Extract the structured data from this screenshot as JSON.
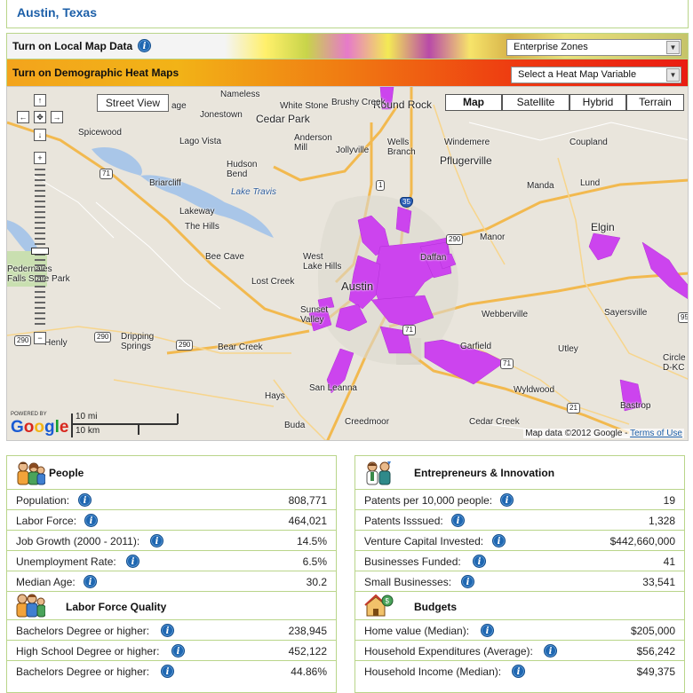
{
  "header": {
    "city": "Austin, Texas"
  },
  "local_map": {
    "label": "Turn on Local Map Data",
    "select_value": "Enterprise Zones"
  },
  "heat_map": {
    "label": "Turn on Demographic Heat Maps",
    "select_value": "Select a Heat Map Variable"
  },
  "map": {
    "street_view": "Street View",
    "types": [
      "Map",
      "Satellite",
      "Hybrid",
      "Terrain"
    ],
    "active_type": "Map",
    "scale_mi": "10 mi",
    "scale_km": "10 km",
    "powered_by": "POWERED BY",
    "logo": "Google",
    "attribution": "Map data ©2012 Google - ",
    "terms": "Terms of Use",
    "places": {
      "nameless": "Nameless",
      "round_rock": "Round Rock",
      "white_stone": "White Stone",
      "brushy_creek": "Brushy Creek",
      "jonestown": "Jonestown",
      "cedar_park": "Cedar Park",
      "spicewood": "Spicewood",
      "lago_vista": "Lago Vista",
      "anderson_mill": "Anderson\nMill",
      "jollyville": "Jollyville",
      "wells_branch": "Wells\nBranch",
      "windemere": "Windemere",
      "pflugerville": "Pflugerville",
      "coupland": "Coupland",
      "briarcliff": "Briarcliff",
      "hudson_bend": "Hudson\nBend",
      "lake_travis": "Lake Travis",
      "manda": "Manda",
      "lund": "Lund",
      "lakeway": "Lakeway",
      "the_hills": "The Hills",
      "elgin": "Elgin",
      "manor": "Manor",
      "bee_cave": "Bee Cave",
      "west_lake_hills": "West\nLake Hills",
      "daffan": "Daffan",
      "pedernales": "Pedernales\nFalls State Park",
      "lost_creek": "Lost Creek",
      "austin": "Austin",
      "webberville": "Webberville",
      "sayersville": "Sayersville",
      "sunset_valley": "Sunset\nValley",
      "henly": "Henly",
      "dripping_springs": "Dripping\nSprings",
      "garfield": "Garfield",
      "utley": "Utley",
      "bear_creek": "Bear Creek",
      "circle_d": "Circle\nD-KC",
      "wyldwood": "Wyldwood",
      "hays": "Hays",
      "san_leanna": "San Leanna",
      "cedar_creek": "Cedar Creek",
      "bastrop": "Bastrop",
      "creedmoor": "Creedmoor",
      "buda": "Buda",
      "sage": "age"
    },
    "shields": {
      "s71a": "71",
      "s1": "1",
      "s35": "35",
      "s290a": "290",
      "s71b": "71",
      "s290b": "290",
      "s290c": "290",
      "s290d": "290",
      "s71c": "71",
      "s21": "21",
      "s71d": "71",
      "s95": "95"
    }
  },
  "people": {
    "title": "People",
    "rows": [
      {
        "label": "Population:",
        "value": "808,771"
      },
      {
        "label": "Labor Force:",
        "value": "464,021"
      },
      {
        "label": "Job Growth (2000 - 2011):",
        "value": "14.5%"
      },
      {
        "label": "Unemployment Rate:",
        "value": "6.5%"
      },
      {
        "label": "Median Age:",
        "value": "30.2"
      }
    ]
  },
  "labor": {
    "title": "Labor Force Quality",
    "rows": [
      {
        "label": "Bachelors Degree or higher:",
        "value": "238,945"
      },
      {
        "label": "High School Degree or higher:",
        "value": "452,122"
      },
      {
        "label": "Bachelors Degree or higher:",
        "value": "44.86%"
      }
    ]
  },
  "entrepreneurs": {
    "title": "Entrepreneurs & Innovation",
    "rows": [
      {
        "label": "Patents per 10,000 people:",
        "value": "19"
      },
      {
        "label": "Patents Isssued:",
        "value": "1,328"
      },
      {
        "label": "Venture Capital Invested:",
        "value": "$442,660,000"
      },
      {
        "label": "Businesses Funded:",
        "value": "41"
      },
      {
        "label": "Small Businesses:",
        "value": "33,541"
      }
    ]
  },
  "budgets": {
    "title": "Budgets",
    "rows": [
      {
        "label": "Home value (Median):",
        "value": "$205,000"
      },
      {
        "label": "Household Expenditures (Average):",
        "value": "$56,242"
      },
      {
        "label": "Household Income (Median):",
        "value": "$49,375"
      }
    ]
  },
  "icons": {
    "info": "info-icon",
    "select_arrow": "chevron-down-icon"
  },
  "colors": {
    "heat_overlay": "#cc44ee",
    "title_blue": "#1c5fa8",
    "panel_border": "#b9d58a"
  }
}
